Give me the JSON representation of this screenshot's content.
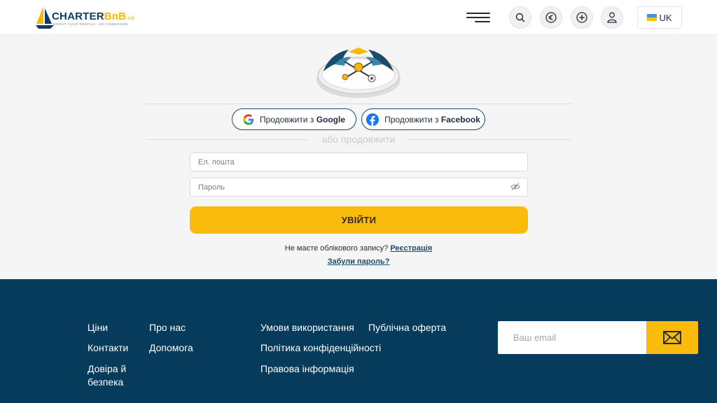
{
  "header": {
    "logo_brand_part1": "CHARTER",
    "logo_brand_part2": "BnB",
    "logo_domain": ".ua",
    "logo_tagline": "DIRECT YACHT RENTALS · NO COMMISSION",
    "language_label": "UK",
    "icons": [
      "menu-icon",
      "search-icon",
      "euro-icon",
      "plus-circle-icon",
      "user-icon",
      "flag-ua-icon"
    ]
  },
  "login": {
    "google_prefix": "Продовжити з ",
    "google_brand": "Google",
    "facebook_prefix": "Продовжити з ",
    "facebook_brand": "Facebook",
    "or_text": "або продовжити",
    "email_placeholder": "Ел. пошта",
    "password_placeholder": "Пароль",
    "submit_label": "УВІЙТИ",
    "no_account_text": "Не маєте облікового запису?",
    "register_link": "Реєстрація",
    "forgot_link": "Забули пароль?"
  },
  "footer": {
    "col1": [
      "Ціни",
      "Контакти",
      "Довіра й безпека"
    ],
    "col2": [
      "Про нас",
      "Допомога"
    ],
    "col3": [
      "Умови використання",
      "Політика конфіденційності",
      "Правова інформація"
    ],
    "col4": [
      "Публічна оферта"
    ],
    "email_placeholder": "Ваш email"
  },
  "colors": {
    "accent_yellow": "#fbbb0c",
    "navy": "#063b5c",
    "button_border": "#1b4b68",
    "facebook_blue": "#1877f2"
  }
}
